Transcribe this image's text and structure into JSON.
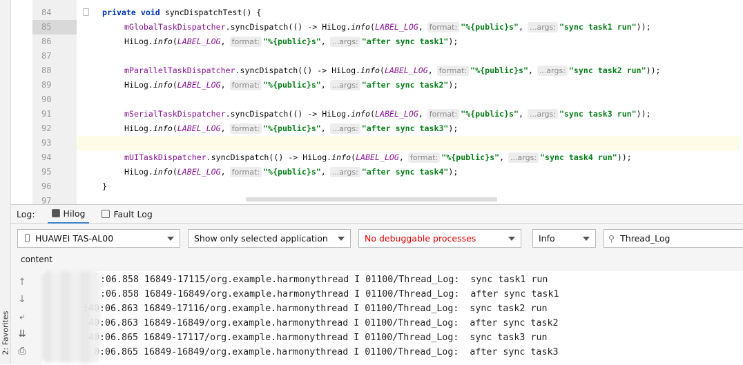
{
  "sidebar": {
    "favorites_label": "2: Favorites"
  },
  "editor": {
    "lines": [
      {
        "n": "84",
        "tokens": [
          [
            "kw",
            "private void "
          ],
          [
            "",
            "syncDispatchTest() {"
          ]
        ]
      },
      {
        "n": "85",
        "tokens": [
          [
            "field",
            "mGlobalTaskDispatcher"
          ],
          [
            "",
            ".syncDispatch(() -> HiLog."
          ],
          [
            "it",
            "info"
          ],
          [
            "",
            "("
          ],
          [
            "static",
            "LABEL_LOG"
          ],
          [
            "",
            ","
          ],
          [
            "hint",
            "format:"
          ],
          [
            "str",
            "\"%{public}s\""
          ],
          [
            "",
            ","
          ],
          [
            "hint",
            "...args:"
          ],
          [
            "str",
            "\"sync task1 run\""
          ],
          [
            "",
            "));"
          ]
        ]
      },
      {
        "n": "86",
        "tokens": [
          [
            "",
            "HiLog."
          ],
          [
            "it",
            "info"
          ],
          [
            "",
            "("
          ],
          [
            "static",
            "LABEL_LOG"
          ],
          [
            "",
            ","
          ],
          [
            "hint",
            "format:"
          ],
          [
            "str",
            "\"%{public}s\""
          ],
          [
            "",
            ","
          ],
          [
            "hint",
            "...args:"
          ],
          [
            "str",
            "\"after sync task1\""
          ],
          [
            "",
            ");"
          ]
        ]
      },
      {
        "n": "87",
        "tokens": []
      },
      {
        "n": "88",
        "tokens": [
          [
            "field",
            "mParallelTaskDispatcher"
          ],
          [
            "",
            ".syncDispatch(() -> HiLog."
          ],
          [
            "it",
            "info"
          ],
          [
            "",
            "("
          ],
          [
            "static",
            "LABEL_LOG"
          ],
          [
            "",
            ","
          ],
          [
            "hint",
            "format:"
          ],
          [
            "str",
            "\"%{public}s\""
          ],
          [
            "",
            ","
          ],
          [
            "hint",
            "...args:"
          ],
          [
            "str",
            "\"sync task2 run\""
          ],
          [
            "",
            "));"
          ]
        ]
      },
      {
        "n": "89",
        "tokens": [
          [
            "",
            "HiLog."
          ],
          [
            "it",
            "info"
          ],
          [
            "",
            "("
          ],
          [
            "static",
            "LABEL_LOG"
          ],
          [
            "",
            ","
          ],
          [
            "hint",
            "format:"
          ],
          [
            "str",
            "\"%{public}s\""
          ],
          [
            "",
            ","
          ],
          [
            "hint",
            "...args:"
          ],
          [
            "str",
            "\"after sync task2\""
          ],
          [
            "",
            ");"
          ]
        ]
      },
      {
        "n": "90",
        "tokens": []
      },
      {
        "n": "91",
        "tokens": [
          [
            "field",
            "mSerialTaskDispatcher"
          ],
          [
            "",
            ".syncDispatch(() -> HiLog."
          ],
          [
            "it",
            "info"
          ],
          [
            "",
            "("
          ],
          [
            "static",
            "LABEL_LOG"
          ],
          [
            "",
            ","
          ],
          [
            "hint",
            "format:"
          ],
          [
            "str",
            "\"%{public}s\""
          ],
          [
            "",
            ","
          ],
          [
            "hint",
            "...args:"
          ],
          [
            "str",
            "\"sync task3 run\""
          ],
          [
            "",
            "));"
          ]
        ]
      },
      {
        "n": "92",
        "tokens": [
          [
            "",
            "HiLog."
          ],
          [
            "it",
            "info"
          ],
          [
            "",
            "("
          ],
          [
            "static",
            "LABEL_LOG"
          ],
          [
            "",
            ","
          ],
          [
            "hint",
            "format:"
          ],
          [
            "str",
            "\"%{public}s\""
          ],
          [
            "",
            ","
          ],
          [
            "hint",
            "...args:"
          ],
          [
            "str",
            "\"after sync task3\""
          ],
          [
            "",
            ");"
          ]
        ]
      },
      {
        "n": "93",
        "tokens": []
      },
      {
        "n": "94",
        "tokens": [
          [
            "field",
            "mUITaskDispatcher"
          ],
          [
            "",
            ".syncDispatch(() -> HiLog."
          ],
          [
            "it",
            "info"
          ],
          [
            "",
            "("
          ],
          [
            "static",
            "LABEL_LOG"
          ],
          [
            "",
            ","
          ],
          [
            "hint",
            "format:"
          ],
          [
            "str",
            "\"%{public}s\""
          ],
          [
            "",
            ","
          ],
          [
            "hint",
            "...args:"
          ],
          [
            "str",
            "\"sync task4 run\""
          ],
          [
            "",
            "));"
          ]
        ]
      },
      {
        "n": "95",
        "tokens": [
          [
            "",
            "HiLog."
          ],
          [
            "it",
            "info"
          ],
          [
            "",
            "("
          ],
          [
            "static",
            "LABEL_LOG"
          ],
          [
            "",
            ","
          ],
          [
            "hint",
            "format:"
          ],
          [
            "str",
            "\"%{public}s\""
          ],
          [
            "",
            ","
          ],
          [
            "hint",
            "...args:"
          ],
          [
            "str",
            "\"after sync task4\""
          ],
          [
            "",
            ");"
          ]
        ]
      },
      {
        "n": "96",
        "tokens": [
          [
            "",
            "}"
          ]
        ]
      },
      {
        "n": "97",
        "tokens": []
      }
    ],
    "current_line": "93",
    "selected_line": "85"
  },
  "log": {
    "label": "Log:",
    "tabs": [
      {
        "label": "Hilog",
        "active": true
      },
      {
        "label": "Fault Log",
        "active": false
      }
    ],
    "device": "HUAWEI TAS-AL00",
    "filter_mode": "Show only selected application",
    "process": "No debuggable processes",
    "process_color": "#e00000",
    "level": "Info",
    "search_value": "Thread_Log",
    "column_header": "content",
    "rows": [
      ":06.858 16849-17115/org.example.harmonythread I 01100/Thread_Log:  sync task1 run",
      ":06.858 16849-16849/org.example.harmonythread I 01100/Thread_Log:  after sync task1",
      ":40:06.863 16849-17116/org.example.harmonythread I 01100/Thread_Log:  sync task2 run",
      "40:06.863 16849-16849/org.example.harmonythread I 01100/Thread_Log:  after sync task2",
      "40:06.865 16849-17117/org.example.harmonythread I 01100/Thread_Log:  sync task3 run",
      "0:06.865 16849-16849/org.example.harmonythread I 01100/Thread_Log:  after sync task3"
    ]
  }
}
